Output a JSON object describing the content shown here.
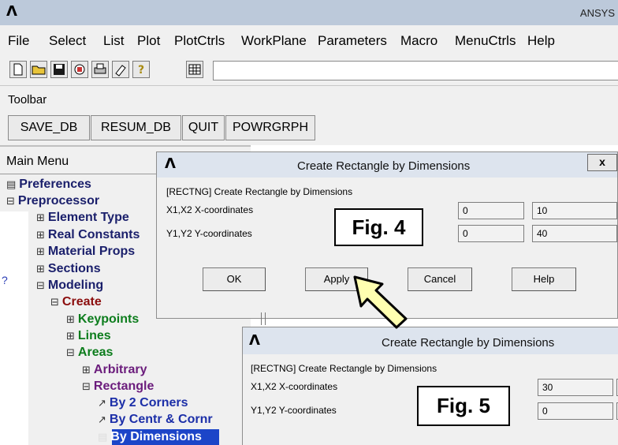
{
  "app": {
    "title": "ANSYS",
    "logo": "Λ"
  },
  "menubar": [
    "File",
    "Select",
    "List",
    "Plot",
    "PlotCtrls",
    "WorkPlane",
    "Parameters",
    "Macro",
    "MenuCtrls",
    "Help"
  ],
  "iconbar": {
    "icons": [
      "new-file",
      "open-folder",
      "save",
      "database",
      "print",
      "report",
      "help",
      "command-grid"
    ]
  },
  "toolbar": {
    "label": "Toolbar",
    "buttons": [
      "SAVE_DB",
      "RESUM_DB",
      "QUIT",
      "POWRGRPH"
    ]
  },
  "main_menu": {
    "title": "Main Menu",
    "stray_text": "?",
    "items": [
      {
        "symbol": "▤",
        "label": "Preferences"
      },
      {
        "symbol": "⊟",
        "label": "Preprocessor"
      },
      {
        "symbol": "⊞",
        "label": "Element Type"
      },
      {
        "symbol": "⊞",
        "label": "Real Constants"
      },
      {
        "symbol": "⊞",
        "label": "Material Props"
      },
      {
        "symbol": "⊞",
        "label": "Sections"
      },
      {
        "symbol": "⊟",
        "label": "Modeling"
      },
      {
        "symbol": "⊟",
        "label": "Create"
      },
      {
        "symbol": "⊞",
        "label": "Keypoints"
      },
      {
        "symbol": "⊞",
        "label": "Lines"
      },
      {
        "symbol": "⊟",
        "label": "Areas"
      },
      {
        "symbol": "⊞",
        "label": "Arbitrary"
      },
      {
        "symbol": "⊟",
        "label": "Rectangle"
      },
      {
        "symbol": "↗",
        "label": "By 2 Corners"
      },
      {
        "symbol": "↗",
        "label": "By Centr & Cornr"
      },
      {
        "symbol": "▤",
        "label": "By Dimensions",
        "selected": true
      }
    ]
  },
  "dialog_fig4": {
    "title": "Create Rectangle by Dimensions",
    "close": "x",
    "heading": "[RECTNG]  Create Rectangle by Dimensions",
    "x_label": "X1,X2  X-coordinates",
    "y_label": "Y1,Y2  Y-coordinates",
    "x1": "0",
    "x2": "10",
    "y1": "0",
    "y2": "40",
    "buttons": [
      "OK",
      "Apply",
      "Cancel",
      "Help"
    ],
    "fig_label": "Fig. 4"
  },
  "dialog_fig5": {
    "title": "Create Rectangle by Dimensions",
    "heading": "[RECTNG]  Create Rectangle by Dimensions",
    "x_label": "X1,X2  X-coordinates",
    "y_label": "Y1,Y2  Y-coordinates",
    "x1": "30",
    "y1": "0",
    "fig_label": "Fig. 5"
  },
  "colors": {
    "titlebar": "#bcc9da",
    "selected": "#1c45c8",
    "arrow_fill": "#ffffb0"
  }
}
